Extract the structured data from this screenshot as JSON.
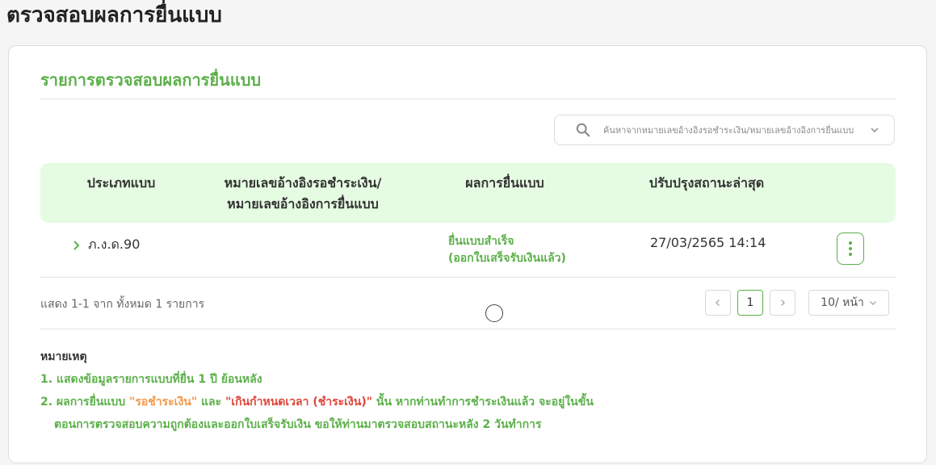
{
  "page": {
    "title": "ตรวจสอบผลการยื่นแบบ"
  },
  "card": {
    "title": "รายการตรวจสอบผลการยื่นแบบ"
  },
  "search": {
    "placeholder": "ค้นหาจากหมายเลขอ้างอิงรอชำระเงิน/หมายเลขอ้างอิงการยื่นแบบ",
    "value": ""
  },
  "table": {
    "headers": {
      "type": "ประเภทแบบ",
      "ref_line1": "หมายเลขอ้างอิงรอชำระเงิน/",
      "ref_line2": "หมายเลขอ้างอิงการยื่นแบบ",
      "result": "ผลการยื่นแบบ",
      "updated": "ปรับปรุงสถานะล่าสุด"
    },
    "rows": [
      {
        "type": "ภ.ง.ด.90",
        "ref": "",
        "result_line1": "ยื่นแบบสำเร็จ",
        "result_line2": "(ออกใบเสร็จรับเงินแล้ว)",
        "updated": "27/03/2565 14:14"
      }
    ]
  },
  "pagination": {
    "summary": "แสดง 1-1 จาก ทั้งหมด 1 รายการ",
    "current_page": "1",
    "page_size": "10/ หน้า"
  },
  "notes": {
    "title": "หมายเหตุ",
    "item1": "1. แสดงข้อมูลรายการแบบที่ยื่น 1 ปี ย้อนหลัง",
    "item2_prefix": "2. ผลการยื่นแบบ ",
    "item2_status_pending": "\"รอชำระเงิน\"",
    "item2_and": " และ ",
    "item2_status_overdue": "\"เกินกำหนดเวลา (ชำระเงิน)\"",
    "item2_suffix": " นั้น หากท่านทำการชำระเงินแล้ว จะอยู่ในขั้น",
    "item2_line2": "ตอนการตรวจสอบความถูกต้องและออกใบเสร็จรับเงิน ขอให้ท่านมาตรวจสอบสถานะหลัง 2 วันทำการ"
  },
  "colors": {
    "accent_green": "#5cb04a",
    "header_bg": "#e5fbe2",
    "status_pending": "#f2994a",
    "status_overdue": "#e0443a"
  },
  "icons": {
    "search": "search-icon",
    "dropdown": "chevron-down-icon",
    "row_expand": "chevron-right-icon",
    "row_menu": "more-vertical-icon",
    "prev": "chevron-left-icon",
    "next": "chevron-right-icon"
  }
}
